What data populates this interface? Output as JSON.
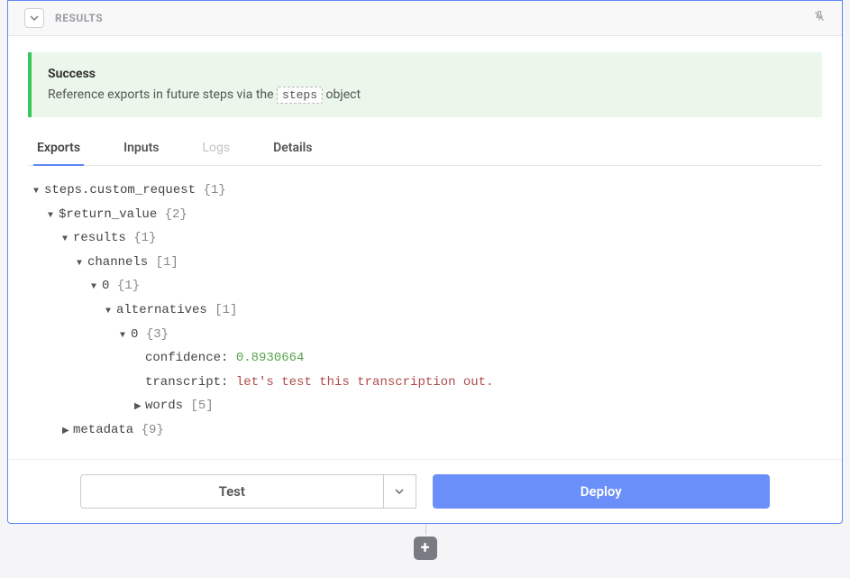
{
  "header": {
    "title": "RESULTS"
  },
  "alert": {
    "title": "Success",
    "desc_prefix": "Reference exports in future steps via the ",
    "code": "steps",
    "desc_suffix": " object"
  },
  "tabs": [
    {
      "label": "Exports",
      "active": true
    },
    {
      "label": "Inputs",
      "active": false
    },
    {
      "label": "Logs",
      "active": false,
      "dim": true
    },
    {
      "label": "Details",
      "active": false
    }
  ],
  "tree": {
    "rows": [
      {
        "depth": 0,
        "caret": "down",
        "label": "steps.custom_request",
        "suffix": "{1}"
      },
      {
        "depth": 1,
        "caret": "down",
        "label": "$return_value",
        "suffix": "{2}"
      },
      {
        "depth": 2,
        "caret": "down",
        "label": "results",
        "suffix": "{1}"
      },
      {
        "depth": 3,
        "caret": "down",
        "label": "channels",
        "suffix": "[1]"
      },
      {
        "depth": 4,
        "caret": "down",
        "label": "0",
        "suffix": "{1}"
      },
      {
        "depth": 5,
        "caret": "down",
        "label": "alternatives",
        "suffix": "[1]"
      },
      {
        "depth": 6,
        "caret": "down",
        "label": "0",
        "suffix": "{3}"
      },
      {
        "depth": 7,
        "caret": "none",
        "kv": true,
        "key": "confidence",
        "value": "0.8930664",
        "vtype": "num"
      },
      {
        "depth": 7,
        "caret": "none",
        "kv": true,
        "key": "transcript",
        "value": "let's test this transcription out.",
        "vtype": "str"
      },
      {
        "depth": 7,
        "caret": "right",
        "label": "words",
        "suffix": "[5]"
      },
      {
        "depth": 2,
        "caret": "right",
        "label": "metadata",
        "suffix": "{9}"
      }
    ]
  },
  "actions": {
    "test": "Test",
    "deploy": "Deploy"
  }
}
